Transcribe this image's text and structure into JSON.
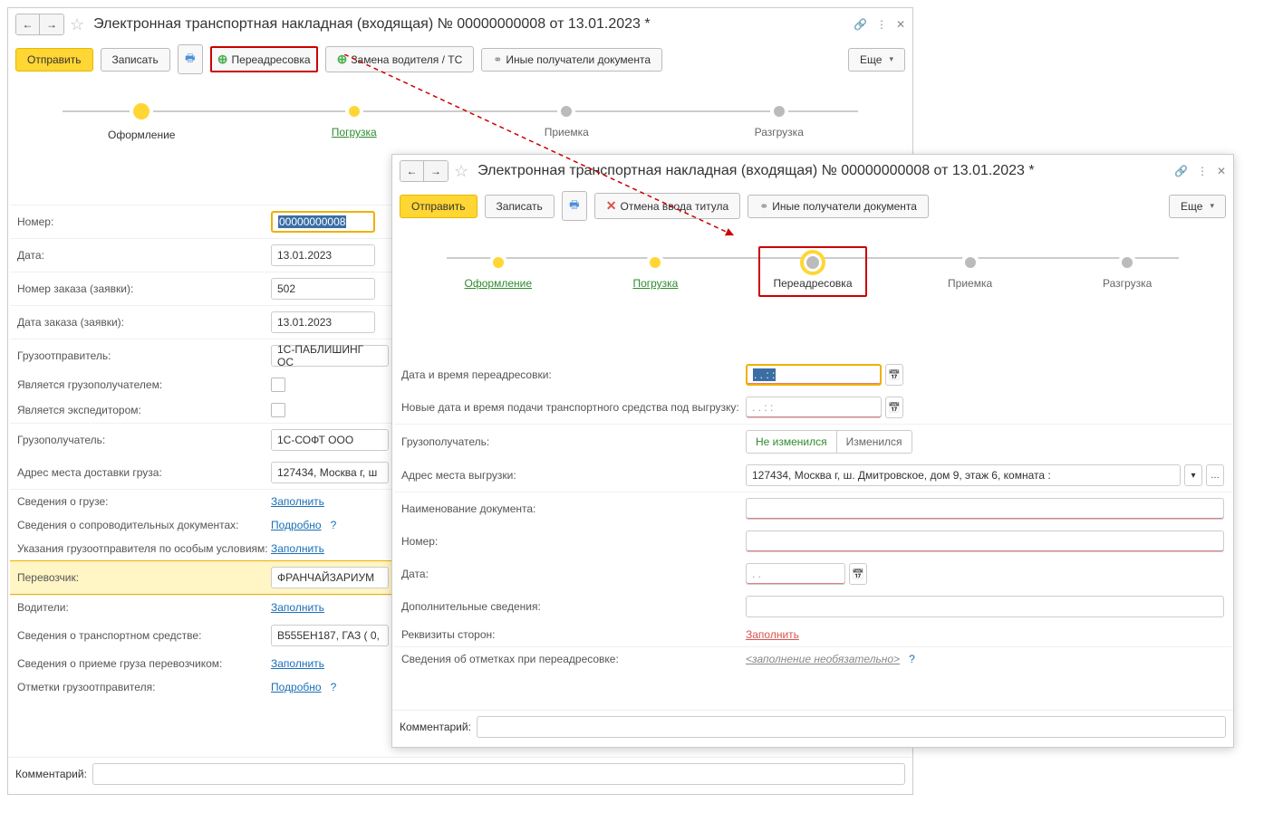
{
  "w1": {
    "title": "Электронная транспортная накладная (входящая) № 00000000008 от 13.01.2023 *",
    "toolbar": {
      "send": "Отправить",
      "save": "Записать",
      "redirect": "Переадресовка",
      "driver": "Замена водителя / ТС",
      "recipients": "Иные получатели документа",
      "more": "Еще"
    },
    "stages": {
      "s1": "Оформление",
      "s2": "Погрузка",
      "s3": "Приемка",
      "s4": "Разгрузка"
    },
    "form": {
      "number_l": "Номер:",
      "number_v": "00000000008",
      "date_l": "Дата:",
      "date_v": "13.01.2023",
      "order_num_l": "Номер заказа (заявки):",
      "order_num_v": "502",
      "order_date_l": "Дата заказа (заявки):",
      "order_date_v": "13.01.2023",
      "shipper_l": "Грузоотправитель:",
      "shipper_v": "1С-ПАБЛИШИНГ ОС",
      "is_consignee_l": "Является грузополучателем:",
      "is_forwarder_l": "Является экспедитором:",
      "consignee_l": "Грузополучатель:",
      "consignee_v": "1С-СОФТ ООО",
      "addr_l": "Адрес места доставки груза:",
      "addr_v": "127434, Москва г, ш",
      "cargo_l": "Сведения о грузе:",
      "cargo_link": "Заполнить",
      "docs_l": "Сведения о сопроводительных документах:",
      "docs_link": "Подробно",
      "instr_l": "Указания грузоотправителя по особым условиям:",
      "instr_link": "Заполнить",
      "carrier_l": "Перевозчик:",
      "carrier_v": "ФРАНЧАЙЗАРИУМ",
      "drivers_l": "Водители:",
      "drivers_link": "Заполнить",
      "vehicle_l": "Сведения о транспортном средстве:",
      "vehicle_v": "В555ЕН187, ГАЗ ( 0,",
      "accept_l": "Сведения о приеме груза перевозчиком:",
      "accept_link": "Заполнить",
      "notes_l": "Отметки грузоотправителя:",
      "notes_link": "Подробно",
      "comment_l": "Комментарий:"
    }
  },
  "w2": {
    "title": "Электронная транспортная накладная (входящая) № 00000000008 от 13.01.2023 *",
    "toolbar": {
      "send": "Отправить",
      "save": "Записать",
      "cancel_title": "Отмена ввода титула",
      "recipients": "Иные получатели документа",
      "more": "Еще"
    },
    "stages": {
      "s1": "Оформление",
      "s2": "Погрузка",
      "s3": "Переадресовка",
      "s4": "Приемка",
      "s5": "Разгрузка"
    },
    "form": {
      "redir_dt_l": "Дата и время переадресовки:",
      "redir_dt_v": "  .  .       :  :  ",
      "new_dt_l": "Новые дата и время подачи транспортного средства под выгрузку:",
      "new_dt_v": ".  .       :  :",
      "consignee_l": "Грузополучатель:",
      "toggle_same": "Не изменился",
      "toggle_changed": "Изменился",
      "unload_addr_l": "Адрес места выгрузки:",
      "unload_addr_v": "127434, Москва г, ш. Дмитровское, дом 9, этаж 6, комната :",
      "doc_name_l": "Наименование документа:",
      "num_l": "Номер:",
      "date_l": "Дата:",
      "date_v": ".  .",
      "extra_l": "Дополнительные сведения:",
      "parties_l": "Реквизиты сторон:",
      "parties_link": "Заполнить",
      "marks_l": "Сведения об отметках при переадресовке:",
      "marks_link": "<заполнение необязательно>",
      "comment_l": "Комментарий:"
    }
  }
}
